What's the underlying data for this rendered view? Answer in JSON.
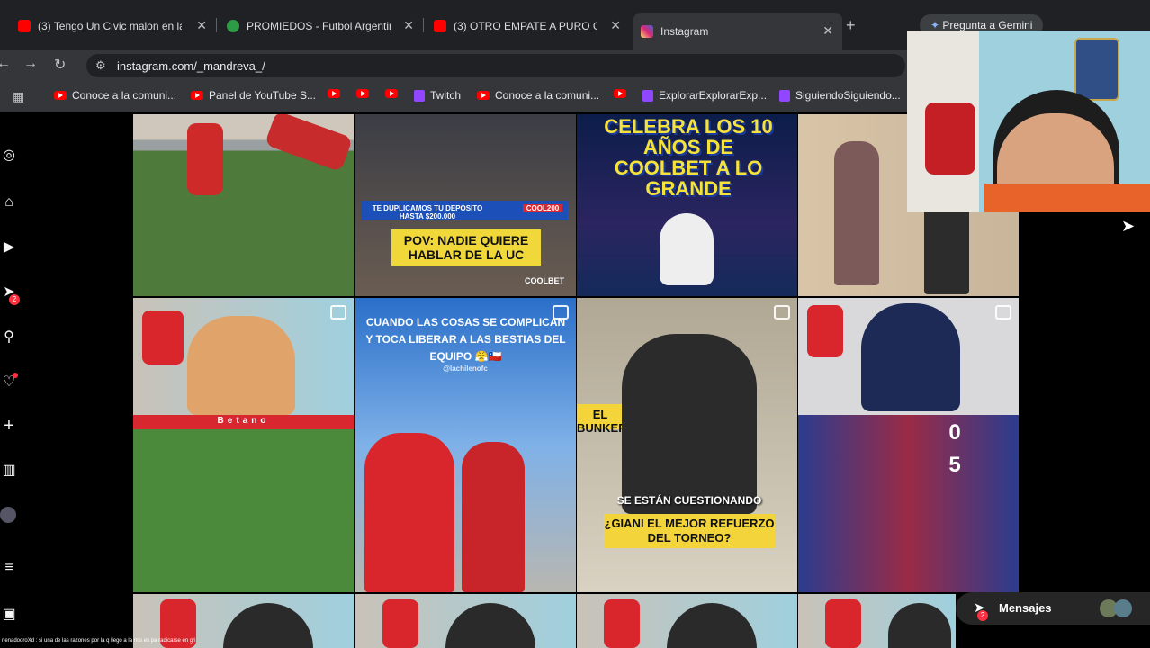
{
  "tabs": [
    {
      "title": "(3) Tengo Un Civic malon en la",
      "icon": "youtube-icon"
    },
    {
      "title": "PROMIEDOS - Futbol Argentin",
      "icon": "soccer-ball-icon"
    },
    {
      "title": "(3) OTRO EMPATE A PURO GO",
      "icon": "youtube-icon"
    },
    {
      "title": "Instagram",
      "icon": "instagram-icon"
    }
  ],
  "gemini_label": "Pregunta a Gemini",
  "address": {
    "url": "instagram.com/_mandreva_/"
  },
  "bookmarks": [
    {
      "label": "Conoce a la comuni...",
      "icon": "youtube-icon"
    },
    {
      "label": "Panel de YouTube S...",
      "icon": "youtube-icon"
    },
    {
      "label": "",
      "icon": "youtube-icon"
    },
    {
      "label": "",
      "icon": "youtube-icon"
    },
    {
      "label": "",
      "icon": "youtube-icon"
    },
    {
      "label": "Twitch",
      "icon": "twitch-icon"
    },
    {
      "label": "Conoce a la comuni...",
      "icon": "youtube-icon"
    },
    {
      "label": "",
      "icon": "youtube-icon"
    },
    {
      "label": "ExplorarExplorarExp...",
      "icon": "twitch-icon"
    },
    {
      "label": "SiguiendoSiguiendo...",
      "icon": "twitch-icon"
    }
  ],
  "sidebar": {
    "messages_badge": "2"
  },
  "posts": {
    "p2_promo": "TE DUPLICAMOS TU DEPOSITO HASTA $200.000",
    "p2_code": "COOL200",
    "p2_caption": "POV: NADIE QUIERE HABLAR DE LA UC",
    "p2_brand": "COOLBET",
    "p3_caption": "CELEBRA LOS 10 AÑOS DE COOLBET A LO GRANDE",
    "p6_caption": "CUANDO LAS COSAS SE COMPLICAN Y TOCA LIBERAR A LAS BESTIAS DEL EQUIPO 😤🇨🇱",
    "p6_handle": "@lachilenofc",
    "p7_tag": "EL BUNKER",
    "p7_sub": "SE ESTÁN CUESTIONANDO",
    "p7_caption": "¿GIANI EL MEJOR REFUERZO DEL TORNEO?",
    "p8_score_top": "0",
    "p8_score_bottom": "5",
    "p5_ads": "Betano"
  },
  "messages": {
    "label": "Mensajes",
    "badge": "2"
  },
  "chat_overlay": "nenadooroXd : si una de las razones por la q llego a la mls es pa radicarse en gri"
}
